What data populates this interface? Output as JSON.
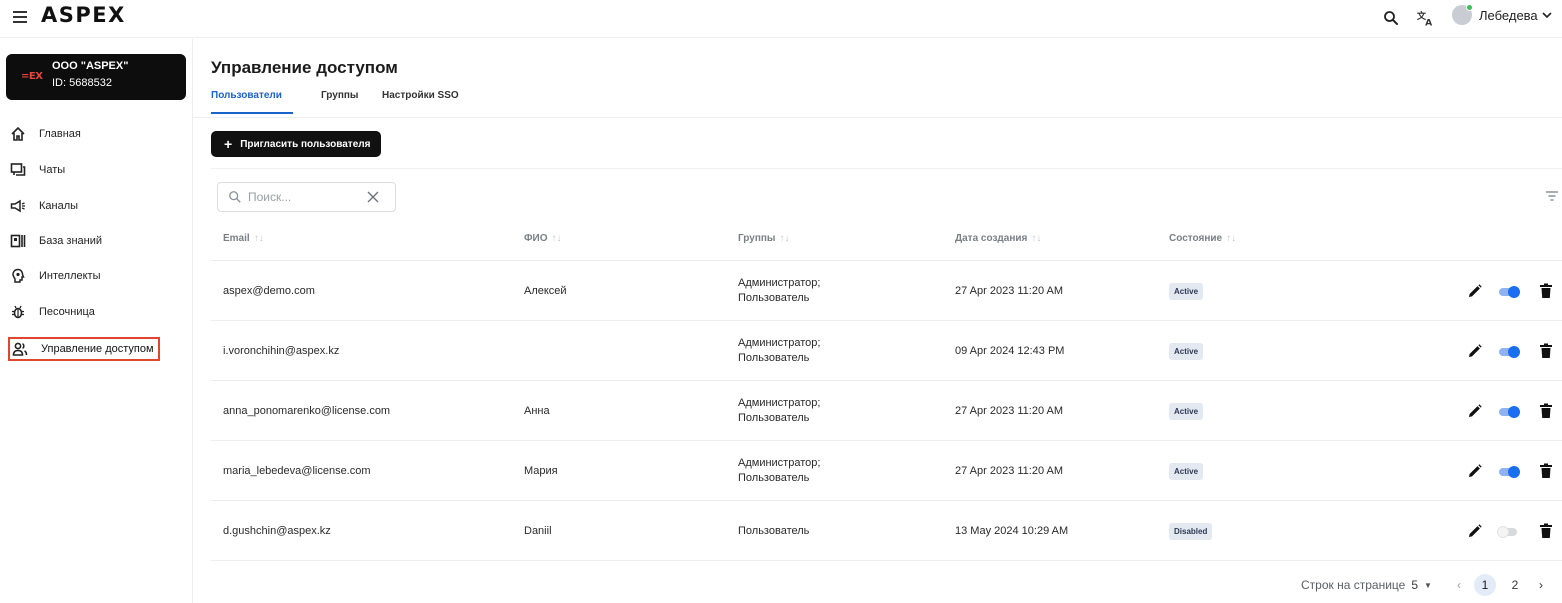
{
  "header": {
    "logo": "ASPEX",
    "user_name": "Лебедева"
  },
  "org": {
    "logo": "=EX",
    "name": "ООО \"ASPEX\"",
    "id": "ID: 5688532"
  },
  "sidebar": {
    "items": [
      {
        "label": "Главная",
        "icon": "home-icon"
      },
      {
        "label": "Чаты",
        "icon": "chat-icon"
      },
      {
        "label": "Каналы",
        "icon": "megaphone-icon"
      },
      {
        "label": "База знаний",
        "icon": "knowledge-base-icon"
      },
      {
        "label": "Интеллекты",
        "icon": "brain-icon"
      },
      {
        "label": "Песочница",
        "icon": "bug-icon"
      },
      {
        "label": "Управление доступом",
        "icon": "users-icon",
        "active": true
      }
    ]
  },
  "main": {
    "title": "Управление доступом",
    "tabs": [
      {
        "label": "Пользователи",
        "active": true
      },
      {
        "label": "Группы"
      },
      {
        "label": "Настройки SSO"
      }
    ],
    "invite_button": "Пригласить пользователя",
    "search_placeholder": "Поиск..."
  },
  "table": {
    "columns": [
      "Email",
      "ФИО",
      "Группы",
      "Дата создания",
      "Состояние"
    ],
    "rows": [
      {
        "email": "aspex@demo.com",
        "name": "Алексей",
        "groups": [
          "Администратор;",
          "Пользователь"
        ],
        "created": "27 Apr 2023 11:20 AM",
        "status": "Active",
        "enabled": true
      },
      {
        "email": "i.voronchihin@aspex.kz",
        "name": "",
        "groups": [
          "Администратор;",
          "Пользователь"
        ],
        "created": "09 Apr 2024 12:43 PM",
        "status": "Active",
        "enabled": true
      },
      {
        "email": "anna_ponomarenko@license.com",
        "name": "Анна",
        "groups": [
          "Администратор;",
          "Пользователь"
        ],
        "created": "27 Apr 2023 11:20 AM",
        "status": "Active",
        "enabled": true
      },
      {
        "email": "maria_lebedeva@license.com",
        "name": "Мария",
        "groups": [
          "Администратор;",
          "Пользователь"
        ],
        "created": "27 Apr 2023 11:20 AM",
        "status": "Active",
        "enabled": true
      },
      {
        "email": "d.gushchin@aspex.kz",
        "name": "Daniil",
        "groups": [
          "Пользователь"
        ],
        "created": "13 May 2024 10:29 AM",
        "status": "Disabled",
        "enabled": false
      }
    ]
  },
  "pagination": {
    "rows_per_page_label": "Строк на странице",
    "rows_per_page": "5",
    "pages": [
      "1",
      "2"
    ],
    "current_page": "1"
  },
  "colors": {
    "accent": "#1a63c8",
    "highlight_border": "#e0452d",
    "toggle_on": "#1a6ef0",
    "org_card": "#0d0d0d"
  }
}
